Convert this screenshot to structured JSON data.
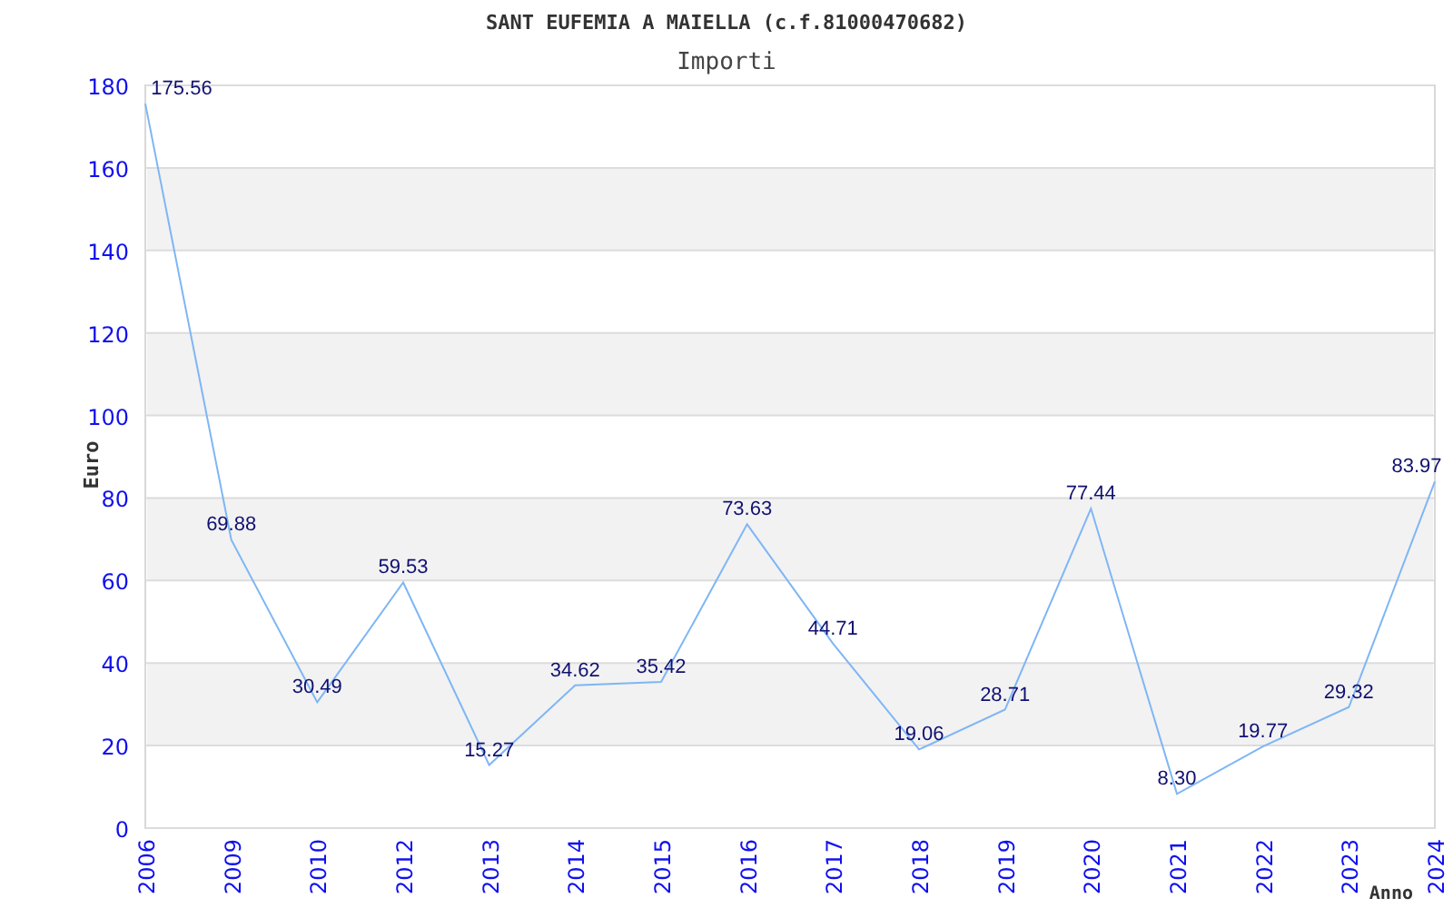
{
  "chart": {
    "subtitle": "Importi",
    "chart_data": {
      "type": "line",
      "title": "SANT EUFEMIA A MAIELLA (c.f.81000470682)",
      "xlabel": "Anno",
      "ylabel": "Euro",
      "categories": [
        "2006",
        "2009",
        "2010",
        "2012",
        "2013",
        "2014",
        "2015",
        "2016",
        "2017",
        "2018",
        "2019",
        "2020",
        "2021",
        "2022",
        "2023",
        "2024"
      ],
      "series": [
        {
          "color": "#7eb6f5",
          "values": [
            175.56,
            69.88,
            30.49,
            59.53,
            15.27,
            34.62,
            35.42,
            73.63,
            44.71,
            19.06,
            28.71,
            77.44,
            8.3,
            19.77,
            29.32,
            83.97
          ]
        }
      ],
      "ylim": [
        0,
        180
      ],
      "yticks": [
        0,
        20,
        40,
        60,
        80,
        100,
        120,
        140,
        160,
        180
      ],
      "grid": true,
      "value_labels": [
        "175.56",
        "69.88",
        "30.49",
        "59.53",
        "15.27",
        "34.62",
        "35.42",
        "73.63",
        "44.71",
        "19.06",
        "28.71",
        "77.44",
        "8.30",
        "19.77",
        "29.32",
        "83.97"
      ]
    }
  }
}
